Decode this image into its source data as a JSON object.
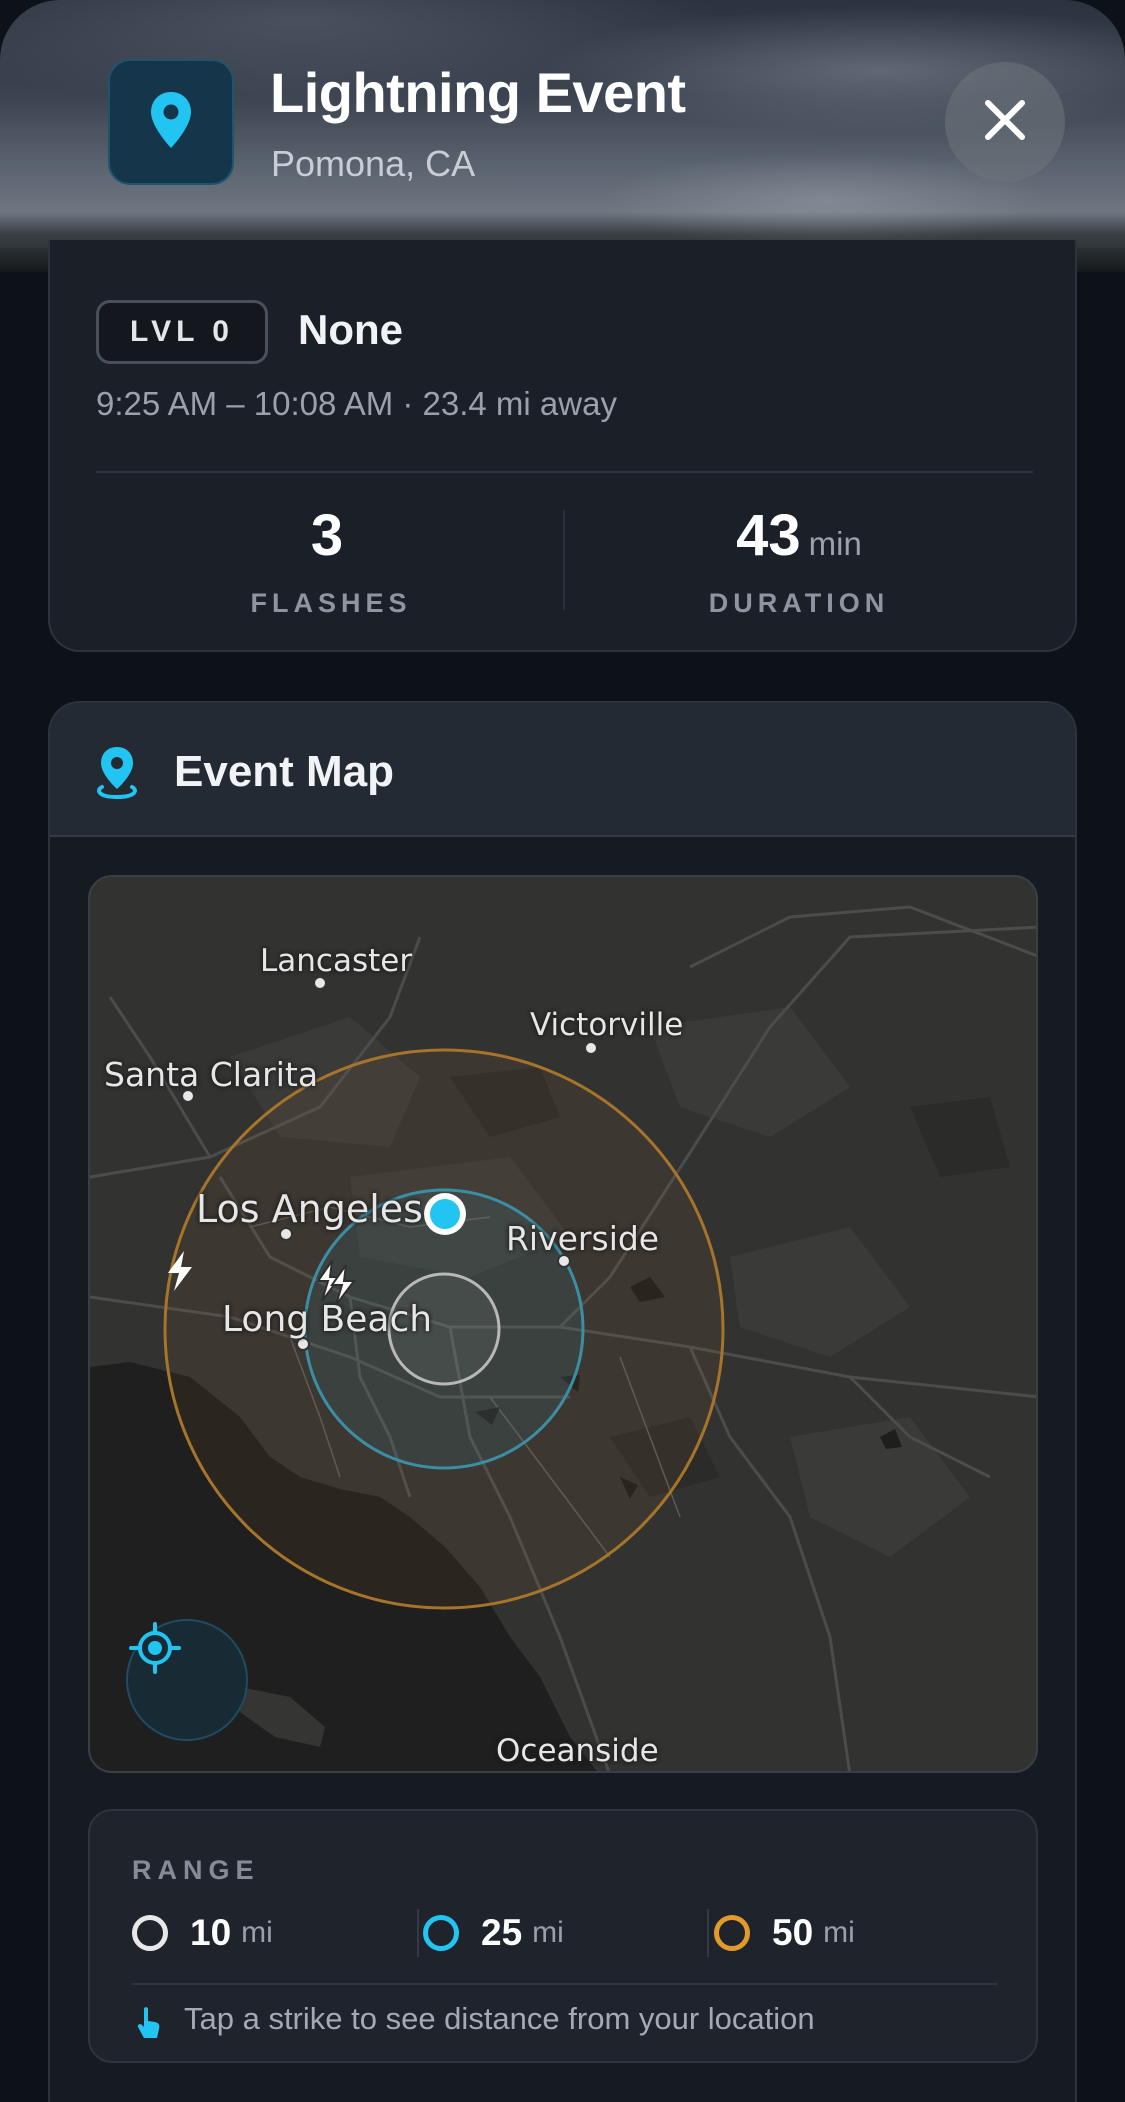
{
  "header": {
    "title": "Lightning Event",
    "location": "Pomona, CA",
    "icon": "map-pin-icon",
    "close_icon": "close-icon"
  },
  "summary": {
    "level_badge": "LVL 0",
    "level_name": "None",
    "time_range": "9:25 AM – 10:08 AM · 23.4 mi away",
    "stats": [
      {
        "value": "3",
        "unit": "",
        "label": "FLASHES"
      },
      {
        "value": "43",
        "unit": "min",
        "label": "DURATION"
      }
    ]
  },
  "map_card": {
    "title": "Event Map",
    "icon": "map-pin-icon",
    "cities": [
      {
        "name": "Lancaster"
      },
      {
        "name": "Victorville"
      },
      {
        "name": "Santa Clarita"
      },
      {
        "name": "Los Angeles"
      },
      {
        "name": "Riverside"
      },
      {
        "name": "Long Beach"
      },
      {
        "name": "Oceanside"
      }
    ],
    "strikes": [
      {
        "type": "single"
      },
      {
        "type": "multiple"
      }
    ],
    "recenter_icon": "locate-icon"
  },
  "range": {
    "title": "RANGE",
    "items": [
      {
        "value": "10",
        "unit": "mi",
        "color": "#e8e8e8"
      },
      {
        "value": "25",
        "unit": "mi",
        "color": "#22c4f2"
      },
      {
        "value": "50",
        "unit": "mi",
        "color": "#e29a2c"
      }
    ],
    "hint": "Tap a strike to see distance from your location",
    "hint_icon": "tap-hand-icon"
  },
  "colors": {
    "accent": "#22c4f2",
    "ring_small": "#bdbdbd",
    "ring_mid": "#3d8fa5",
    "ring_large": "#b07a2a"
  }
}
